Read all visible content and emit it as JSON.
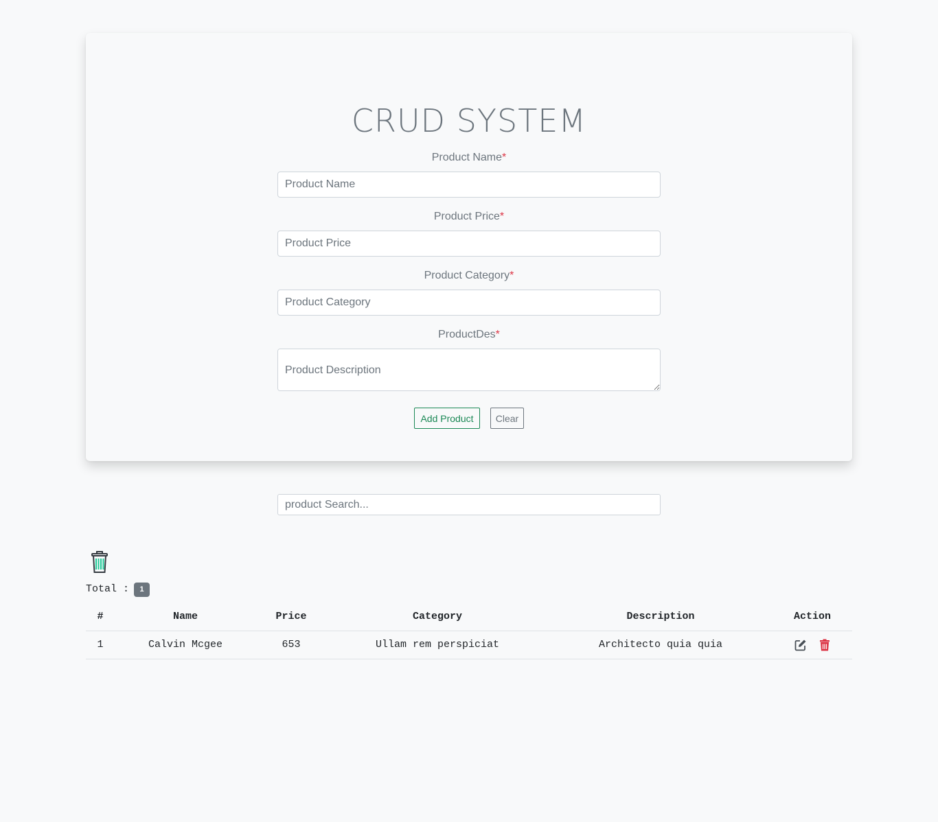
{
  "header": {
    "title": "CRUD SYSTEM"
  },
  "form": {
    "name_label": "Product Name",
    "name_placeholder": "Product Name",
    "price_label": "Product Price",
    "price_placeholder": "Product Price",
    "category_label": "Product Category",
    "category_placeholder": "Product Category",
    "desc_label": "ProductDes",
    "desc_placeholder": "Product Description",
    "required_mark": "*",
    "add_label": "Add Product",
    "clear_label": "Clear"
  },
  "search": {
    "placeholder": "product Search..."
  },
  "summary": {
    "total_label": "Total :",
    "total_count": "1"
  },
  "table": {
    "headers": [
      "#",
      "Name",
      "Price",
      "Category",
      "Description",
      "Action"
    ],
    "rows": [
      {
        "index": "1",
        "name": "Calvin Mcgee",
        "price": "653",
        "category": "Ullam rem perspiciat",
        "description": "Architecto quia quia"
      }
    ]
  },
  "colors": {
    "add": "#198754",
    "delete": "#dc3545",
    "muted": "#6c757d",
    "trash_all": "#20c997"
  }
}
